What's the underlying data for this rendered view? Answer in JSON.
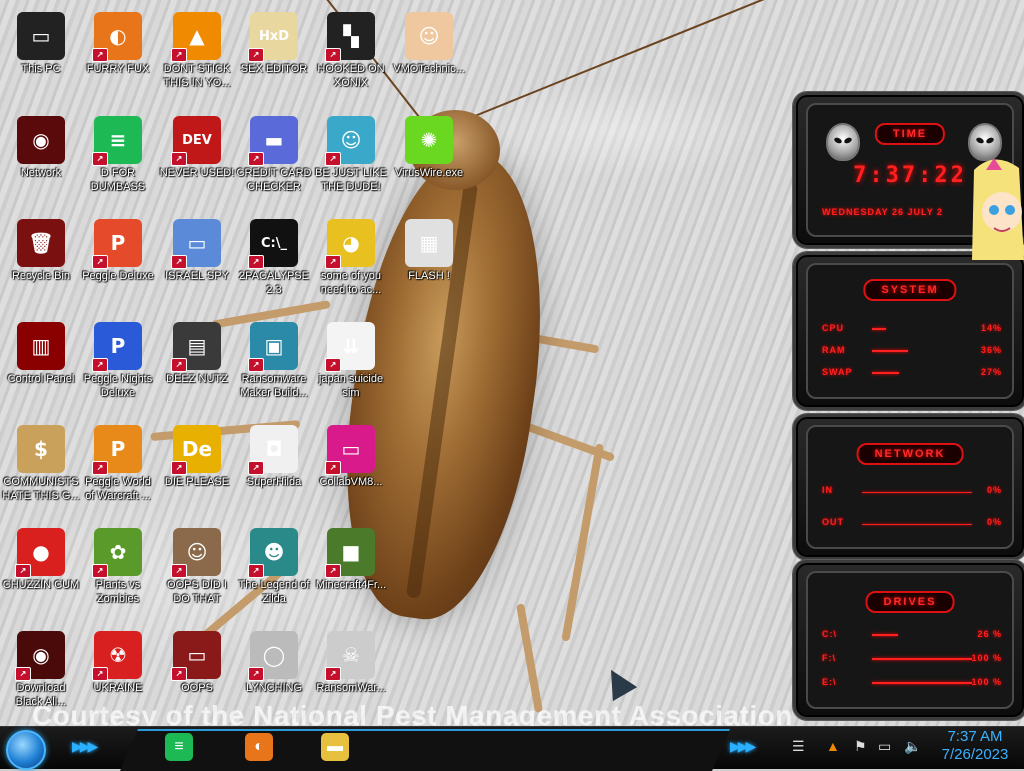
{
  "desktop": {
    "credit": "Courtesy of the National Pest Management Association",
    "icons": [
      {
        "label": "This PC",
        "icon": "monitor-icon",
        "bg": "#222",
        "glyph": "▭",
        "shortcut": false
      },
      {
        "label": "Network",
        "icon": "alienware-network-icon",
        "bg": "#5a0a0a",
        "glyph": "◉",
        "shortcut": false
      },
      {
        "label": "Recycle Bin",
        "icon": "trash-bin-icon",
        "bg": "#7a1010",
        "glyph": "🗑",
        "shortcut": false
      },
      {
        "label": "Control Panel",
        "icon": "control-panel-icon",
        "bg": "#8a0000",
        "glyph": "▥",
        "shortcut": false
      },
      {
        "label": "COMMUNISTS HATE THIS G...",
        "icon": "money-bag-icon",
        "bg": "#c9a15a",
        "glyph": "$",
        "shortcut": false
      },
      {
        "label": "CHUZZIN CUM",
        "icon": "red-fuzzball-icon",
        "bg": "#d9201e",
        "glyph": "●",
        "shortcut": true
      },
      {
        "label": "Download Black All...",
        "icon": "alienware-download-icon",
        "bg": "#4a0a0a",
        "glyph": "◉",
        "shortcut": true
      },
      {
        "label": "FURRY FUX",
        "icon": "firefox-icon",
        "bg": "#e8751a",
        "glyph": "◐",
        "shortcut": true
      },
      {
        "label": "D FOR DUMBASS",
        "icon": "feedly-icon",
        "bg": "#1db954",
        "glyph": "≡",
        "shortcut": true
      },
      {
        "label": "Peggle Deluxe",
        "icon": "peggle-icon",
        "bg": "#e54b2a",
        "glyph": "P",
        "shortcut": true
      },
      {
        "label": "Peggle Nights Deluxe",
        "icon": "peggle-nights-icon",
        "bg": "#2a5ad8",
        "glyph": "P",
        "shortcut": true
      },
      {
        "label": "Peggle World of Warcraft ...",
        "icon": "peggle-wow-icon",
        "bg": "#e88a1a",
        "glyph": "P",
        "shortcut": true
      },
      {
        "label": "Plants vs Zombies",
        "icon": "plants-vs-zombies-icon",
        "bg": "#5a9a2a",
        "glyph": "✿",
        "shortcut": true
      },
      {
        "label": "UKRAINE",
        "icon": "radiation-icon",
        "bg": "#d92020",
        "glyph": "☢",
        "shortcut": true
      },
      {
        "label": "DONT STICK THIS IN YO...",
        "icon": "vlc-cone-icon",
        "bg": "#f08a00",
        "glyph": "▲",
        "shortcut": true
      },
      {
        "label": "NEVER USED!",
        "icon": "devcpp-icon",
        "bg": "#c01818",
        "glyph": "DEV",
        "shortcut": true
      },
      {
        "label": "ISRAEL SPY",
        "icon": "remote-desktop-icon",
        "bg": "#5a8ad8",
        "glyph": "▭",
        "shortcut": true
      },
      {
        "label": "DEEZ NUTZ",
        "icon": "stacked-windows-icon",
        "bg": "#3a3a3a",
        "glyph": "▤",
        "shortcut": true
      },
      {
        "label": "DIE PLEASE",
        "icon": "de-icon",
        "bg": "#e8b000",
        "glyph": "De",
        "shortcut": true
      },
      {
        "label": "OOPS DID I DO THAT",
        "icon": "portrait-icon",
        "bg": "#8a6a4a",
        "glyph": "☺",
        "shortcut": true
      },
      {
        "label": "OOPS",
        "icon": "red-monitor-icon",
        "bg": "#8a1a1a",
        "glyph": "▭",
        "shortcut": true
      },
      {
        "label": "SEX EDITOR",
        "icon": "hxd-icon",
        "bg": "#e8d8a0",
        "glyph": "HxD",
        "shortcut": true
      },
      {
        "label": "CREDIT CARD CHECKER",
        "icon": "credit-card-icon",
        "bg": "#5a6ad8",
        "glyph": "▬",
        "shortcut": true
      },
      {
        "label": "2PACALYPSE 2.3",
        "icon": "terminal-icon",
        "bg": "#111",
        "glyph": "C:\\_",
        "shortcut": true
      },
      {
        "label": "Ransomware Maker Build...",
        "icon": "ransomware-window-icon",
        "bg": "#2a8aa8",
        "glyph": "▣",
        "shortcut": true
      },
      {
        "label": "SuperHilda",
        "icon": "pixel-dog-icon",
        "bg": "#f0f0f0",
        "glyph": "◘",
        "shortcut": true
      },
      {
        "label": "The Legend of Zilda",
        "icon": "pixel-hero-icon",
        "bg": "#2a8a8a",
        "glyph": "☻",
        "shortcut": true
      },
      {
        "label": "LYNCHING",
        "icon": "noose-icon",
        "bg": "#bbb",
        "glyph": "◯",
        "shortcut": true
      },
      {
        "label": "HOOKED ON XONIX",
        "icon": "xonix-icon",
        "bg": "#222",
        "glyph": "▚",
        "shortcut": true
      },
      {
        "label": "BE JUST LIKE THE DUDE!",
        "icon": "elf-icon",
        "bg": "#3aa8c8",
        "glyph": "☺",
        "shortcut": true
      },
      {
        "label": "some of you need to ac...",
        "icon": "cartoon-dog-icon",
        "bg": "#e8c020",
        "glyph": "◕",
        "shortcut": true
      },
      {
        "label": "japan suicide sim",
        "icon": "japan-sim-icon",
        "bg": "#f4f4f4",
        "glyph": "⇊",
        "shortcut": true
      },
      {
        "label": "CollabVM8...",
        "icon": "collabvm-icon",
        "bg": "#d81a8a",
        "glyph": "▭",
        "shortcut": true
      },
      {
        "label": "Minecraft4Fr...",
        "icon": "minecraft-icon",
        "bg": "#4a7a2a",
        "glyph": "■",
        "shortcut": true
      },
      {
        "label": "RansomWar...",
        "icon": "skull-icon",
        "bg": "#ccc",
        "glyph": "☠",
        "shortcut": true
      },
      {
        "label": "VMOTechnic...",
        "icon": "doctor-icon",
        "bg": "#f0c8a0",
        "glyph": "☺",
        "shortcut": false
      },
      {
        "label": "VirusWire.exe",
        "icon": "lime-icon",
        "bg": "#6ad820",
        "glyph": "✺",
        "shortcut": false
      },
      {
        "label": "FLASH !",
        "icon": "flash-window-icon",
        "bg": "#e0e0e0",
        "glyph": "▦",
        "shortcut": false
      }
    ]
  },
  "widgets": {
    "time": {
      "title": "TIME",
      "clock": "7:37:22",
      "date": "WEDNESDAY 26 JULY 2"
    },
    "system": {
      "title": "SYSTEM",
      "rows": [
        {
          "label": "CPU",
          "value": "14%",
          "fill": 0.14
        },
        {
          "label": "RAM",
          "value": "36%",
          "fill": 0.36
        },
        {
          "label": "SWAP",
          "value": "27%",
          "fill": 0.27
        }
      ]
    },
    "network": {
      "title": "NETWORK",
      "rows": [
        {
          "label": "IN",
          "value": "0%"
        },
        {
          "label": "OUT",
          "value": "0%"
        }
      ]
    },
    "drives": {
      "title": "DRIVES",
      "rows": [
        {
          "label": "C:\\",
          "value": "26 %",
          "fill": 0.26
        },
        {
          "label": "F:\\",
          "value": "100 %",
          "fill": 1.0
        },
        {
          "label": "E:\\",
          "value": "100 %",
          "fill": 1.0
        }
      ]
    }
  },
  "taskbar": {
    "apps": [
      {
        "name": "feedly-app",
        "icon": "feedly-icon",
        "bg": "#1db954",
        "glyph": "≡"
      },
      {
        "name": "firefox-app",
        "icon": "firefox-icon",
        "bg": "#e8751a",
        "glyph": "◐"
      },
      {
        "name": "explorer-app",
        "icon": "folder-icon",
        "bg": "#e8c040",
        "glyph": "▬"
      }
    ],
    "clock_time": "7:37 AM",
    "clock_date": "7/26/2023"
  }
}
